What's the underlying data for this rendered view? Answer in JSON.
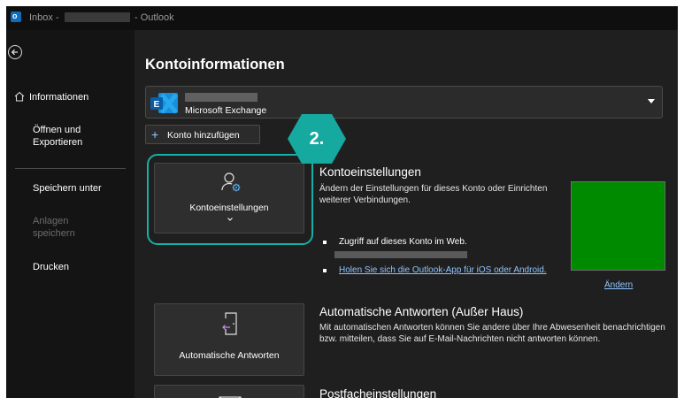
{
  "titlebar": {
    "inbox_label": "Inbox -",
    "app_label": "- Outlook"
  },
  "sidebar": {
    "items": [
      {
        "label": "Informationen"
      },
      {
        "label": "Öffnen und",
        "label2": "Exportieren"
      },
      {
        "label": "Speichern unter"
      },
      {
        "label": "Anlagen",
        "label2": "speichern"
      },
      {
        "label": "Drucken"
      }
    ]
  },
  "main": {
    "title": "Kontoinformationen",
    "account": {
      "type": "Microsoft Exchange"
    },
    "add_account_label": "Konto hinzufügen",
    "step_badge": "2.",
    "account_settings": {
      "tile_label": "Kontoeinstellungen",
      "title": "Kontoeinstellungen",
      "desc": "Ändern der Einstellungen für dieses Konto oder Einrichten weiterer Verbindungen.",
      "bullet1": "Zugriff auf dieses Konto im Web.",
      "bullet2": "Holen Sie sich die Outlook-App für iOS oder Android."
    },
    "change_label": "Ändern",
    "auto_reply": {
      "tile_label": "Automatische Antworten",
      "title": "Automatische Antworten (Außer Haus)",
      "desc": "Mit automatischen Antworten können Sie andere über Ihre Abwesenheit benachrichtigen bzw. mitteilen, dass Sie auf E-Mail-Nachrichten nicht antworten können."
    },
    "mailbox": {
      "title": "Postfacheinstellungen"
    }
  }
}
